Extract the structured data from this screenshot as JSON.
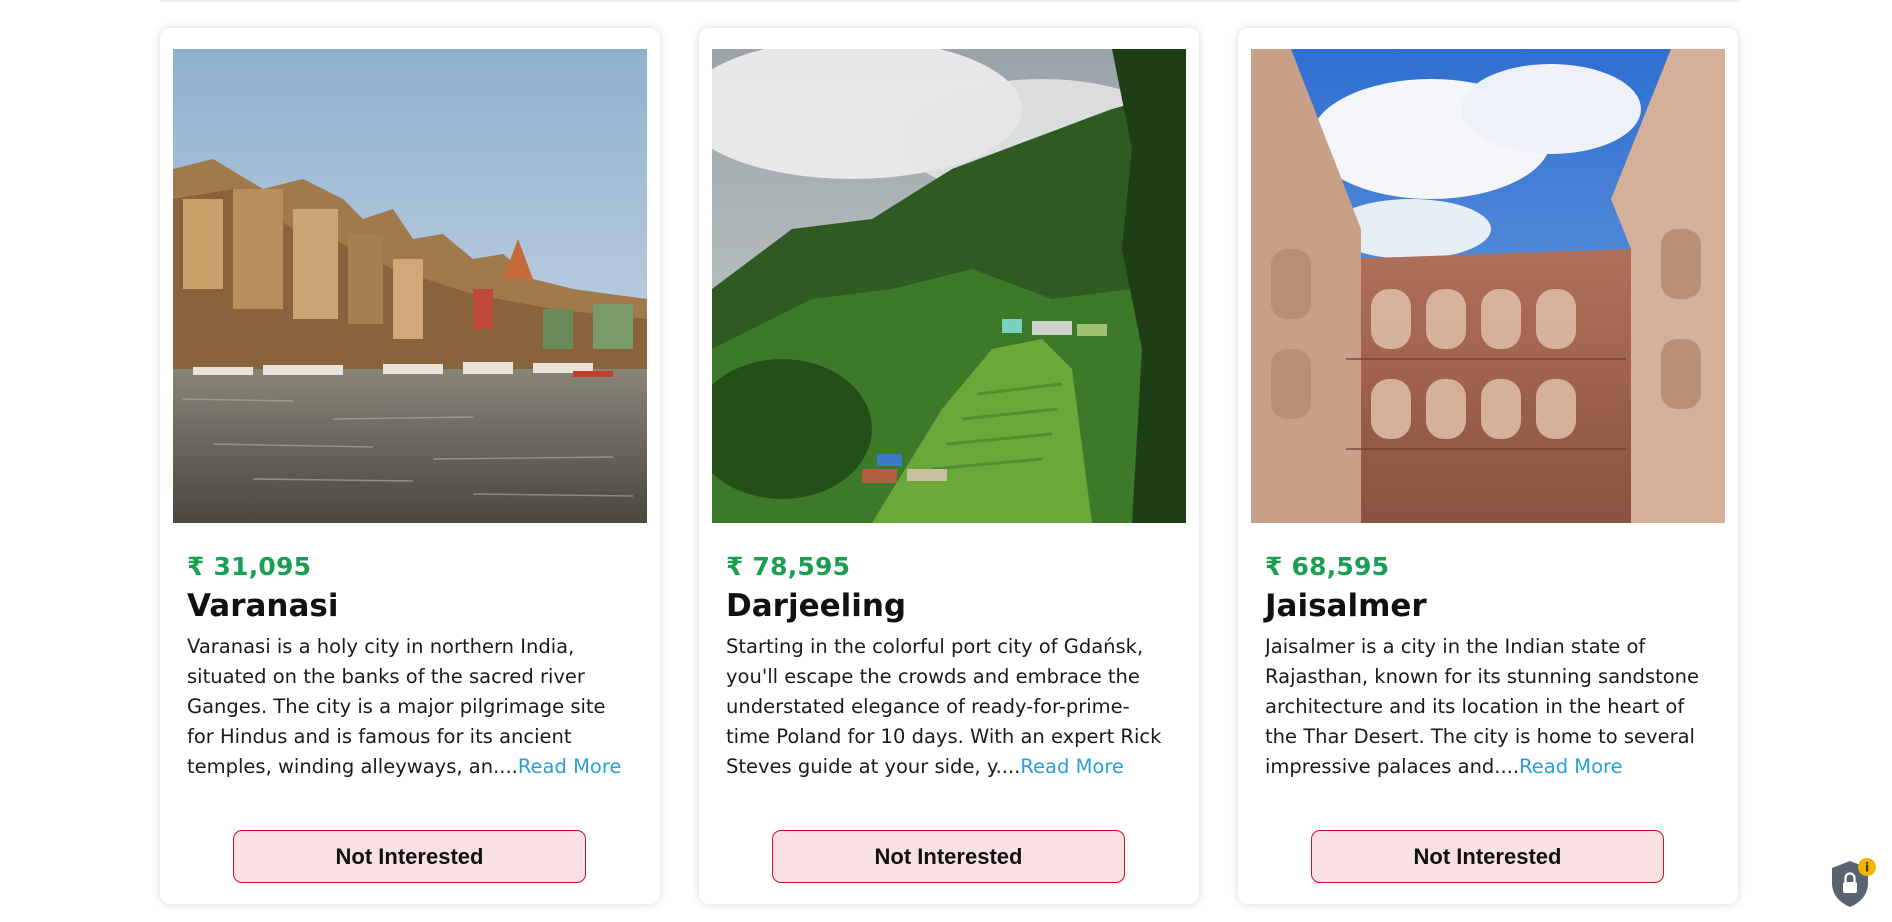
{
  "cards": [
    {
      "image_alt": "Varanasi ghats on the Ganges",
      "price": "₹ 31,095",
      "name": "Varanasi",
      "description": "Varanasi is a holy city in northern India, situated on the banks of the sacred river Ganges. The city is a major pilgrimage site for Hindus and is famous for its ancient temples, winding alleyways, an....",
      "read_more": "Read More",
      "button": "Not Interested"
    },
    {
      "image_alt": "Misty green hills of Darjeeling",
      "price": "₹ 78,595",
      "name": "Darjeeling",
      "description": "Starting in the colorful port city of Gdańsk, you'll escape the crowds and embrace the understated elegance of ready-for-prime-time Poland for 10 days. With an expert Rick Steves guide at your side, y....",
      "read_more": "Read More",
      "button": "Not Interested"
    },
    {
      "image_alt": "Sandstone palace courtyard in Jaisalmer",
      "price": "₹ 68,595",
      "name": "Jaisalmer",
      "description": "Jaisalmer is a city in the Indian state of Rajasthan, known for its stunning sandstone architecture and its location in the heart of the Thar Desert. The city is home to several impressive palaces and....",
      "read_more": "Read More",
      "button": "Not Interested"
    }
  ],
  "colors": {
    "price": "#1a9e52",
    "link": "#2a9fd6",
    "button_bg": "#f8e0e3",
    "button_border": "#c8102e"
  },
  "privacy_badge": {
    "icon": "lock-shield-icon",
    "badge_symbol": "i"
  }
}
